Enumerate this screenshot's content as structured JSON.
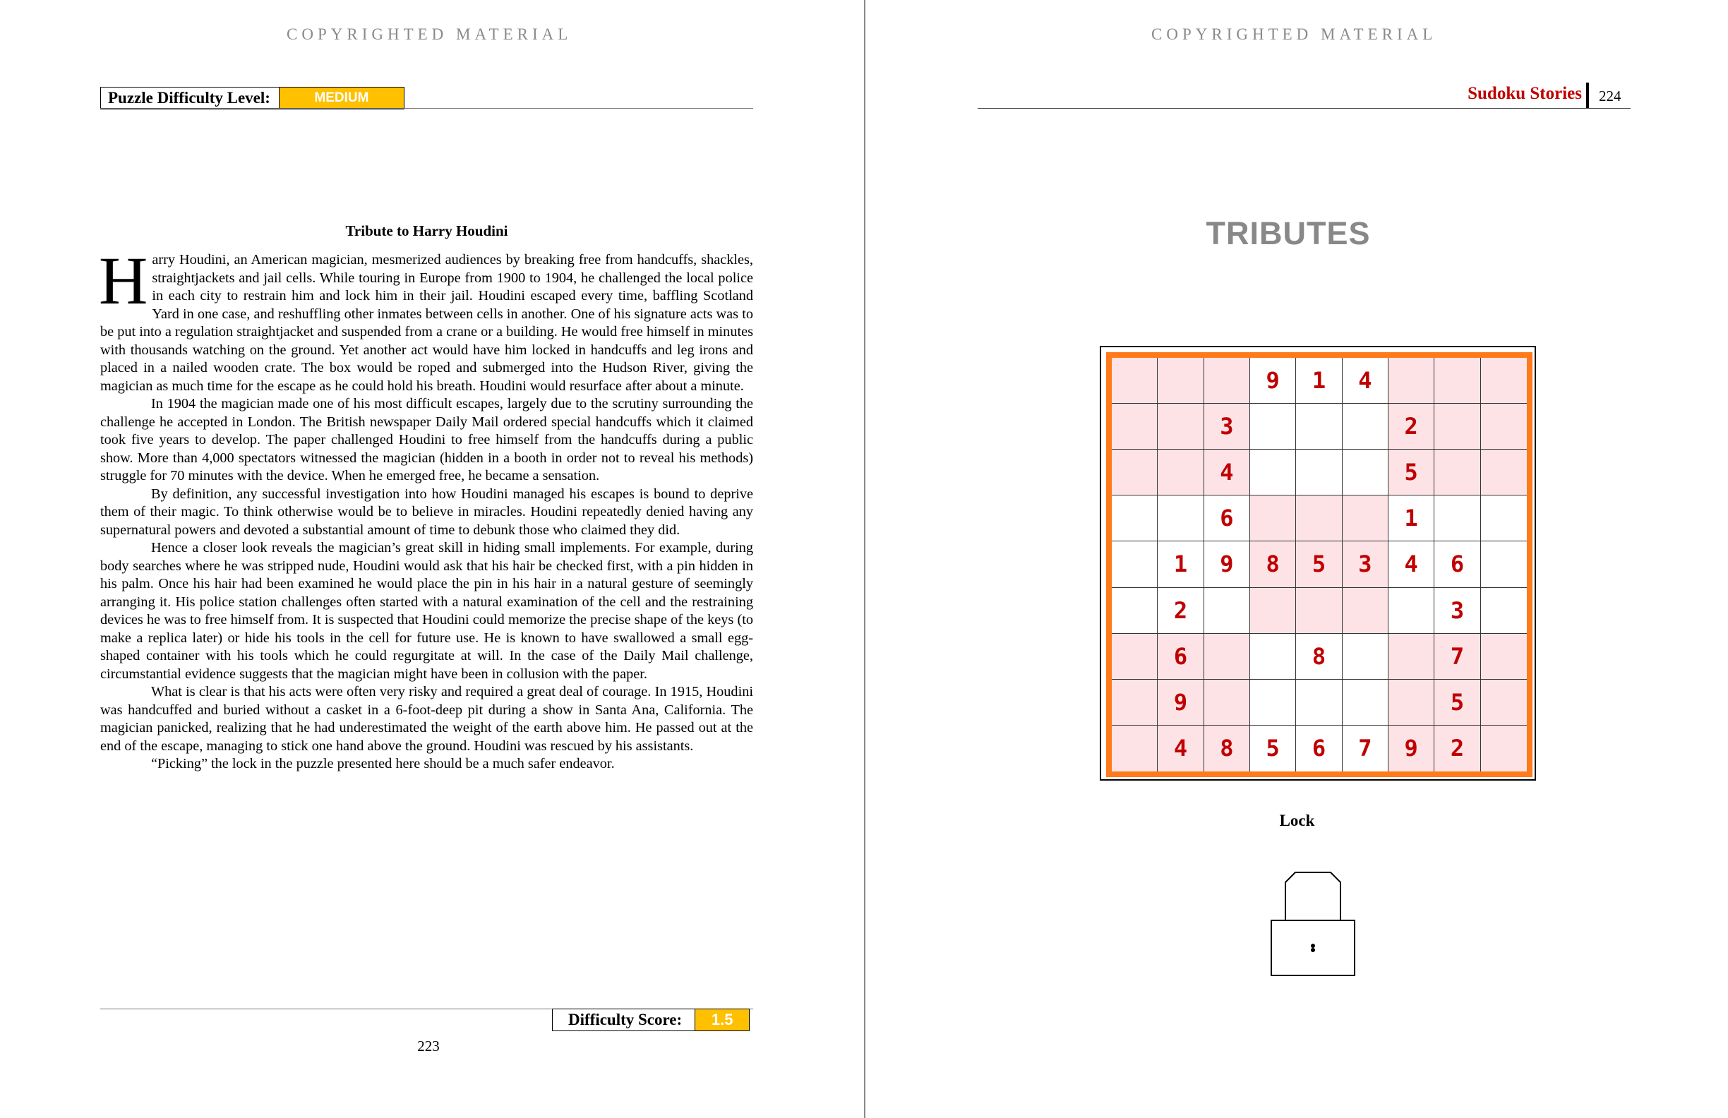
{
  "left_page": {
    "copyright": "COPYRIGHTED MATERIAL",
    "difficulty_label": "Puzzle Difficulty Level:",
    "difficulty_value": "MEDIUM",
    "article_title": "Tribute to Harry Houdini",
    "dropcap": "H",
    "paragraphs": [
      "arry Houdini, an American magician, mesmerized audiences by breaking free from handcuffs, shackles, straightjackets and jail cells. While touring in Europe from 1900 to 1904, he challenged the local police in each city to restrain him and lock him in their jail. Houdini escaped every time, baffling Scotland Yard in one case, and reshuffling other inmates between cells in another. One of his signature acts was to be put into a regulation straightjacket and suspended from a crane or a building. He would free himself in minutes with thousands watching on the ground. Yet another act would have him locked in handcuffs and leg irons and placed in a nailed wooden crate. The box would be roped and submerged into the Hudson River, giving the magician as much time for the escape as he could hold his breath. Houdini would resurface after about a minute.",
      "In 1904 the magician made one of his most difficult escapes, largely due to the scrutiny surrounding the challenge he accepted in London. The British newspaper Daily Mail ordered special handcuffs which it claimed took five years to develop. The paper challenged Houdini to free himself from the handcuffs during a public show. More than 4,000 spectators witnessed the magician (hidden in a booth in order not to reveal his methods) struggle for 70 minutes with the device.  When he emerged free, he became a sensation.",
      "By definition, any successful investigation into how Houdini managed his escapes is bound to deprive them of their magic.  To think otherwise would be to believe in miracles. Houdini repeatedly denied having any supernatural powers and devoted a substantial amount of time to debunk those who claimed they did.",
      "Hence a closer look reveals the magician’s great skill in hiding small implements. For example, during body searches where he was stripped nude, Houdini would ask that his hair be checked first, with a pin hidden in his palm. Once his hair had been examined he would place the pin in his hair in a natural gesture of seemingly arranging it. His police station challenges often started with a natural examination of the cell and the restraining devices he was to free himself from. It is suspected that Houdini could memorize the precise shape of the keys (to make a replica later) or hide his tools in the cell for future use. He is known to have swallowed a small egg-shaped container with his tools which he could regurgitate at will. In the case of the Daily Mail challenge, circumstantial evidence suggests that the magician might have been in collusion with the paper.",
      "What is clear is that his acts were often very risky and required a great deal of courage. In 1915, Houdini was handcuffed and buried without a casket in a 6-foot-deep pit during a show in Santa Ana, California. The magician panicked, realizing that he had underestimated the weight of the earth above him. He passed out at the end of the escape, managing to stick one hand above the ground. Houdini was rescued by his assistants.",
      "“Picking” the lock in the puzzle presented here should be a much safer endeavor."
    ],
    "score_label": "Difficulty Score:",
    "score_value": "1.5",
    "page_number": "223"
  },
  "right_page": {
    "copyright": "COPYRIGHTED MATERIAL",
    "book_title": "Sudoku Stories",
    "page_number": "224",
    "section_heading": "TRIBUTES",
    "puzzle_caption": "Lock",
    "colors": {
      "given_digit": "#c00000",
      "shade": "#fde3e6",
      "frame": "#ff7a1a"
    },
    "grid": [
      [
        "",
        "",
        "",
        "9",
        "1",
        "4",
        "",
        "",
        ""
      ],
      [
        "",
        "",
        "3",
        "",
        "",
        "",
        "2",
        "",
        ""
      ],
      [
        "",
        "",
        "4",
        "",
        "",
        "",
        "5",
        "",
        ""
      ],
      [
        "",
        "",
        "6",
        "",
        "",
        "",
        "1",
        "",
        ""
      ],
      [
        "",
        "1",
        "9",
        "8",
        "5",
        "3",
        "4",
        "6",
        ""
      ],
      [
        "",
        "2",
        "",
        "",
        "",
        "",
        "",
        "3",
        ""
      ],
      [
        "",
        "6",
        "",
        "",
        "8",
        "",
        "",
        "7",
        ""
      ],
      [
        "",
        "9",
        "",
        "",
        "",
        "",
        "",
        "5",
        ""
      ],
      [
        "",
        "4",
        "8",
        "5",
        "6",
        "7",
        "9",
        "2",
        ""
      ]
    ],
    "shaded": [
      [
        1,
        1,
        1,
        0,
        0,
        0,
        1,
        1,
        1
      ],
      [
        1,
        1,
        1,
        0,
        0,
        0,
        1,
        1,
        1
      ],
      [
        1,
        1,
        1,
        0,
        0,
        0,
        1,
        1,
        1
      ],
      [
        0,
        0,
        0,
        1,
        1,
        1,
        0,
        0,
        0
      ],
      [
        0,
        0,
        0,
        1,
        1,
        1,
        0,
        0,
        0
      ],
      [
        0,
        0,
        0,
        1,
        1,
        1,
        0,
        0,
        0
      ],
      [
        1,
        1,
        1,
        0,
        0,
        0,
        1,
        1,
        1
      ],
      [
        1,
        1,
        1,
        0,
        0,
        0,
        1,
        1,
        1
      ],
      [
        1,
        1,
        1,
        0,
        0,
        0,
        1,
        1,
        1
      ]
    ]
  }
}
